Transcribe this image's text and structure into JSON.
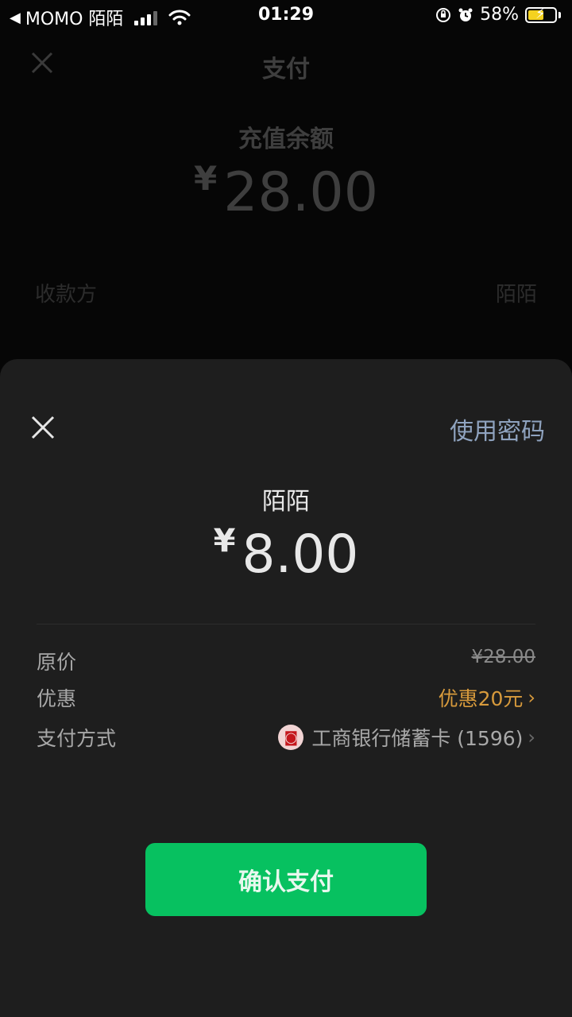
{
  "status_bar": {
    "back_app": "MOMO 陌陌",
    "time": "01:29",
    "battery": "58%",
    "battery_level": 0.58
  },
  "background_page": {
    "title": "支付",
    "label": "充值余额",
    "currency": "¥",
    "amount": "28.00",
    "payee_label": "收款方",
    "payee_value": "陌陌"
  },
  "sheet": {
    "use_password": "使用密码",
    "merchant": "陌陌",
    "currency": "¥",
    "amount": "8.00",
    "rows": {
      "original_price_label": "原价",
      "original_price_value": "¥28.00",
      "discount_label": "优惠",
      "discount_value": "优惠20元",
      "payment_method_label": "支付方式",
      "payment_method_value": "工商银行储蓄卡 (1596)"
    },
    "confirm_button": "确认支付"
  },
  "colors": {
    "confirm_green": "#07c160",
    "discount_orange": "#d79a3c",
    "link_blue_gray": "#8fa3bf"
  }
}
